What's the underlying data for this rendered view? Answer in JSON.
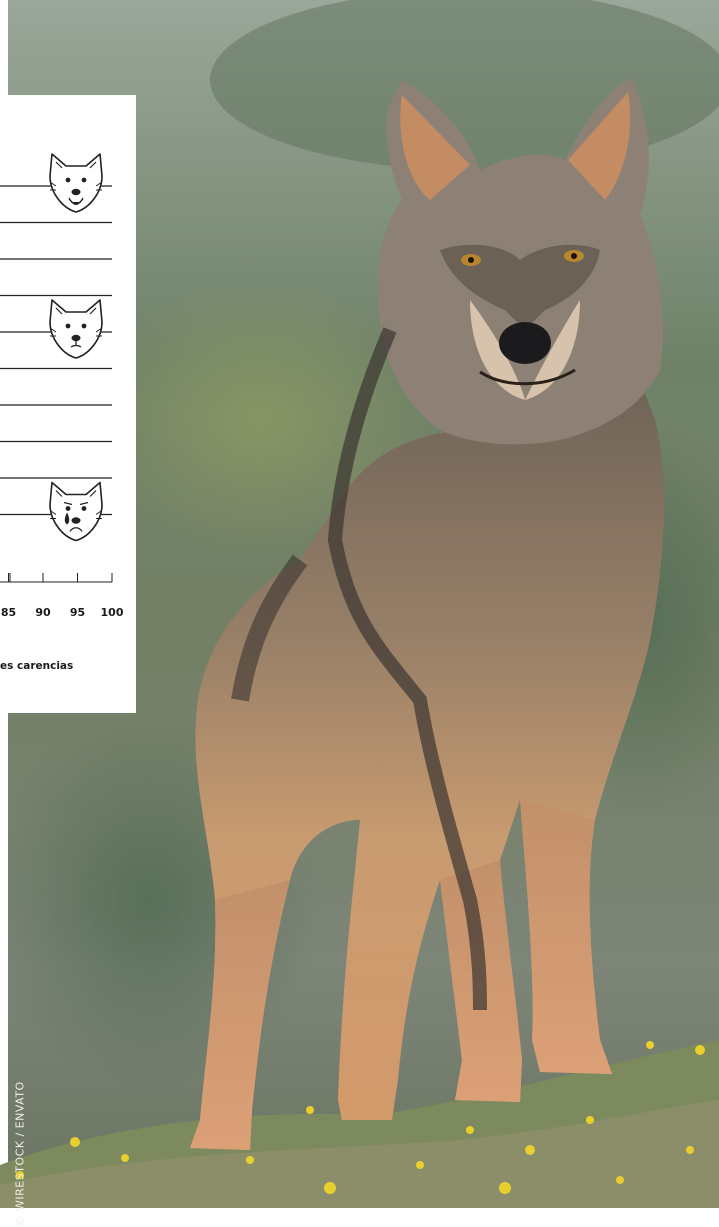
{
  "chart_data": {
    "type": "bar",
    "x_ticks": [
      85,
      90,
      95,
      100
    ],
    "x_tick_labels": [
      "85",
      "90",
      "95",
      "100"
    ],
    "xlim": [
      80,
      100
    ],
    "rows": 10,
    "grid": true,
    "markers": [
      {
        "icon": "happy-wolf-icon",
        "row": 0
      },
      {
        "icon": "neutral-wolf-icon",
        "row": 4
      },
      {
        "icon": "crying-wolf-icon",
        "row": 9
      }
    ],
    "caption": "es carencias"
  },
  "credit": "© WIRESTOCK / ENVATO",
  "colors": {
    "grid": "#222222",
    "text": "#1a1a1a",
    "card": "#ffffff",
    "icon_fill": "#ffffff",
    "icon_stroke": "#222222"
  }
}
